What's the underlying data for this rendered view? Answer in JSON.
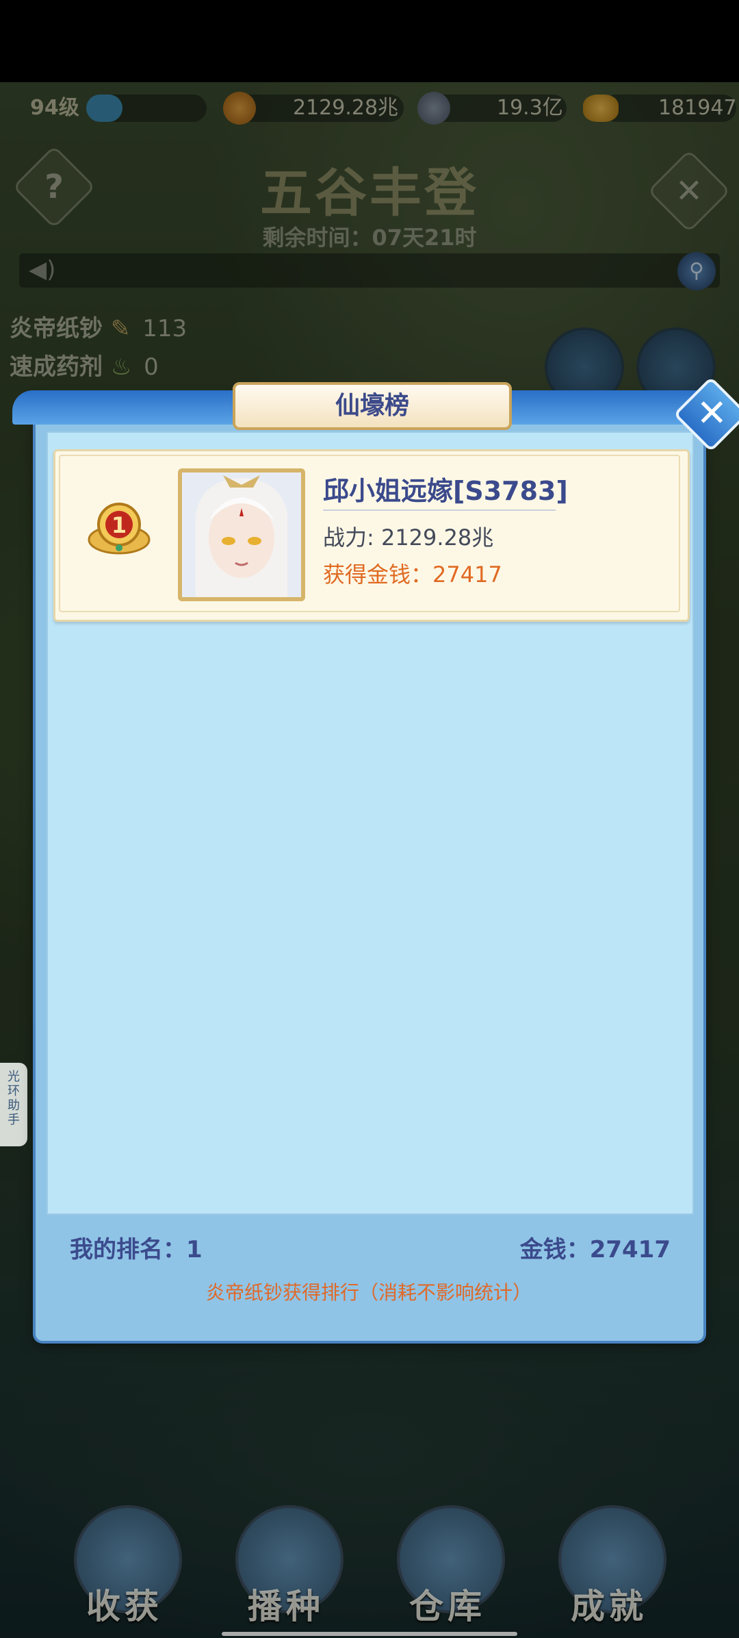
{
  "top_bar": {
    "level": "94级",
    "level_progress": 0.3,
    "power": "2129.28兆",
    "copper": "19.3亿",
    "gold_ingot": "181947"
  },
  "header": {
    "title": "五谷丰登",
    "timer": "剩余时间：07天21时"
  },
  "resources": [
    {
      "label": "炎帝纸钞",
      "value": "113"
    },
    {
      "label": "速成药剂",
      "value": "0"
    }
  ],
  "side_tab": {
    "label": "光环助手"
  },
  "modal": {
    "title": "仙壕榜",
    "entries": [
      {
        "rank": "1",
        "name": "邱小姐远嫁[S3783]",
        "power": "战力: 2129.28兆",
        "gold": "获得金钱：27417"
      }
    ],
    "my_rank": "我的排名：1",
    "my_money": "金钱：27417",
    "note": "炎帝纸钞获得排行（消耗不影响统计）"
  },
  "bottom_nav": [
    {
      "label": "收获"
    },
    {
      "label": "播种"
    },
    {
      "label": "仓库"
    },
    {
      "label": "成就"
    }
  ]
}
